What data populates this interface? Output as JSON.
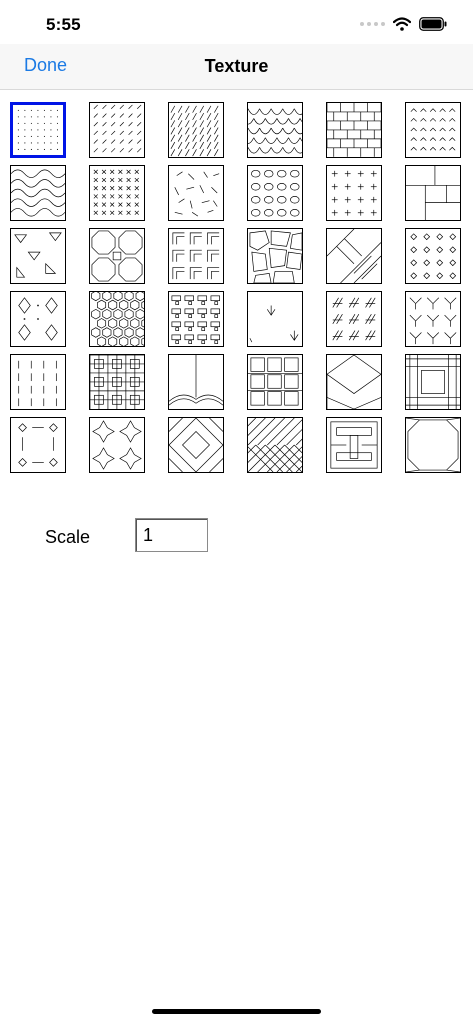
{
  "status_bar": {
    "time": "5:55",
    "icons": [
      "signal-dots-icon",
      "wifi-icon",
      "battery-icon"
    ]
  },
  "nav": {
    "done_label": "Done",
    "title": "Texture",
    "accent_color": "#1b7ae4"
  },
  "textures": {
    "selected_index": 0,
    "selection_color": "#0014e6",
    "items": [
      "dots",
      "dashes",
      "diagonal-lines",
      "scales",
      "bricks",
      "chevrons",
      "waves",
      "crosses",
      "random-lines",
      "pebbles",
      "plus-signs",
      "rectangles",
      "triangles",
      "octagons",
      "maze",
      "stones",
      "basket-weave",
      "diamonds",
      "diamond-dots",
      "hexagons",
      "tiles-pattern",
      "arrows",
      "hatch-marks",
      "y-pattern",
      "vertical-dashes",
      "parquet",
      "open-book",
      "squares-grid",
      "argyle",
      "lattice",
      "diamond-dashes",
      "stars",
      "diagonal-blocks",
      "herringbone",
      "key-pattern",
      "octagon-frame"
    ]
  },
  "scale": {
    "label": "Scale",
    "value": "1"
  }
}
